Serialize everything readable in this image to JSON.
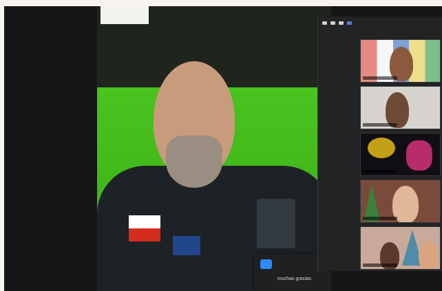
{
  "caption": {
    "text": "muchas gracias"
  },
  "gallery": {
    "toolbar_icons": [
      "minimize-icon",
      "gallery-view-icon",
      "list-view-icon",
      "speaker-view-icon"
    ],
    "participants": [
      {
        "tile": 1,
        "description": "woman-with-flags-background"
      },
      {
        "tile": 2,
        "description": "man-in-office"
      },
      {
        "tile": 3,
        "description": "animated-background"
      },
      {
        "tile": 4,
        "description": "woman-with-christmas-tree"
      },
      {
        "tile": 5,
        "description": "two-people-with-christmas-tree"
      }
    ]
  },
  "colors": {
    "accent": "#2d8cff",
    "panel": "#222324",
    "green_screen": "#45bf1d"
  }
}
